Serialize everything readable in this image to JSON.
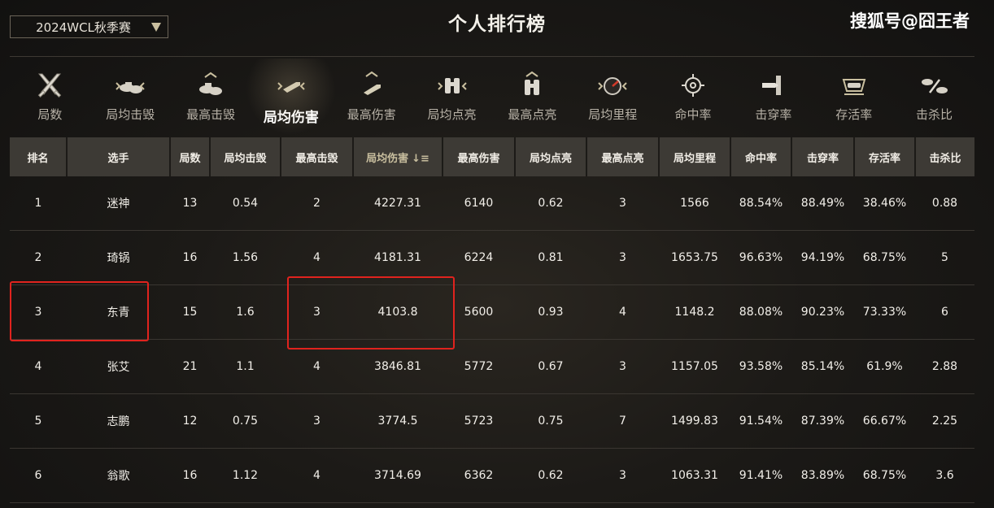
{
  "season_select": {
    "value": "2024WCL秋季赛"
  },
  "title": "个人排行榜",
  "watermark": "搜狐号@囧王者",
  "categories": [
    {
      "label": "局数",
      "icon": "crossed-swords-icon"
    },
    {
      "label": "局均击毁",
      "icon": "destroyed-tanks-icon"
    },
    {
      "label": "最高击毁",
      "icon": "max-destroyed-icon"
    },
    {
      "label": "局均伤害",
      "icon": "shell-damage-icon",
      "active": true
    },
    {
      "label": "最高伤害",
      "icon": "max-damage-icon"
    },
    {
      "label": "局均点亮",
      "icon": "binoculars-icon"
    },
    {
      "label": "最高点亮",
      "icon": "max-binoculars-icon"
    },
    {
      "label": "局均里程",
      "icon": "speedometer-icon"
    },
    {
      "label": "命中率",
      "icon": "crosshair-icon"
    },
    {
      "label": "击穿率",
      "icon": "penetration-shell-icon"
    },
    {
      "label": "存活率",
      "icon": "survival-tank-icon"
    },
    {
      "label": "击杀比",
      "icon": "kill-ratio-icon"
    }
  ],
  "table": {
    "headers": [
      "排名",
      "选手",
      "局数",
      "局均击毁",
      "最高击毁",
      "局均伤害",
      "最高伤害",
      "局均点亮",
      "最高点亮",
      "局均里程",
      "命中率",
      "击穿率",
      "存活率",
      "击杀比"
    ],
    "sorted_column": 5,
    "rows": [
      [
        "1",
        "迷神",
        "13",
        "0.54",
        "2",
        "4227.31",
        "6140",
        "0.62",
        "3",
        "1566",
        "88.54%",
        "88.49%",
        "38.46%",
        "0.88"
      ],
      [
        "2",
        "琦锅",
        "16",
        "1.56",
        "4",
        "4181.31",
        "6224",
        "0.81",
        "3",
        "1653.75",
        "96.63%",
        "94.19%",
        "68.75%",
        "5"
      ],
      [
        "3",
        "东青",
        "15",
        "1.6",
        "3",
        "4103.8",
        "5600",
        "0.93",
        "4",
        "1148.2",
        "88.08%",
        "90.23%",
        "73.33%",
        "6"
      ],
      [
        "4",
        "张艾",
        "21",
        "1.1",
        "4",
        "3846.81",
        "5772",
        "0.67",
        "3",
        "1157.05",
        "93.58%",
        "85.14%",
        "61.9%",
        "2.88"
      ],
      [
        "5",
        "志鹏",
        "12",
        "0.75",
        "3",
        "3774.5",
        "5723",
        "0.75",
        "7",
        "1499.83",
        "91.54%",
        "87.39%",
        "66.67%",
        "2.25"
      ],
      [
        "6",
        "翁歌",
        "16",
        "1.12",
        "4",
        "3714.69",
        "6362",
        "0.62",
        "3",
        "1063.31",
        "91.41%",
        "83.89%",
        "68.75%",
        "3.6"
      ]
    ]
  },
  "colors": {
    "accent": "#c9bf9f",
    "highlight": "#e0231e",
    "header_bg": "#3d3a35"
  }
}
